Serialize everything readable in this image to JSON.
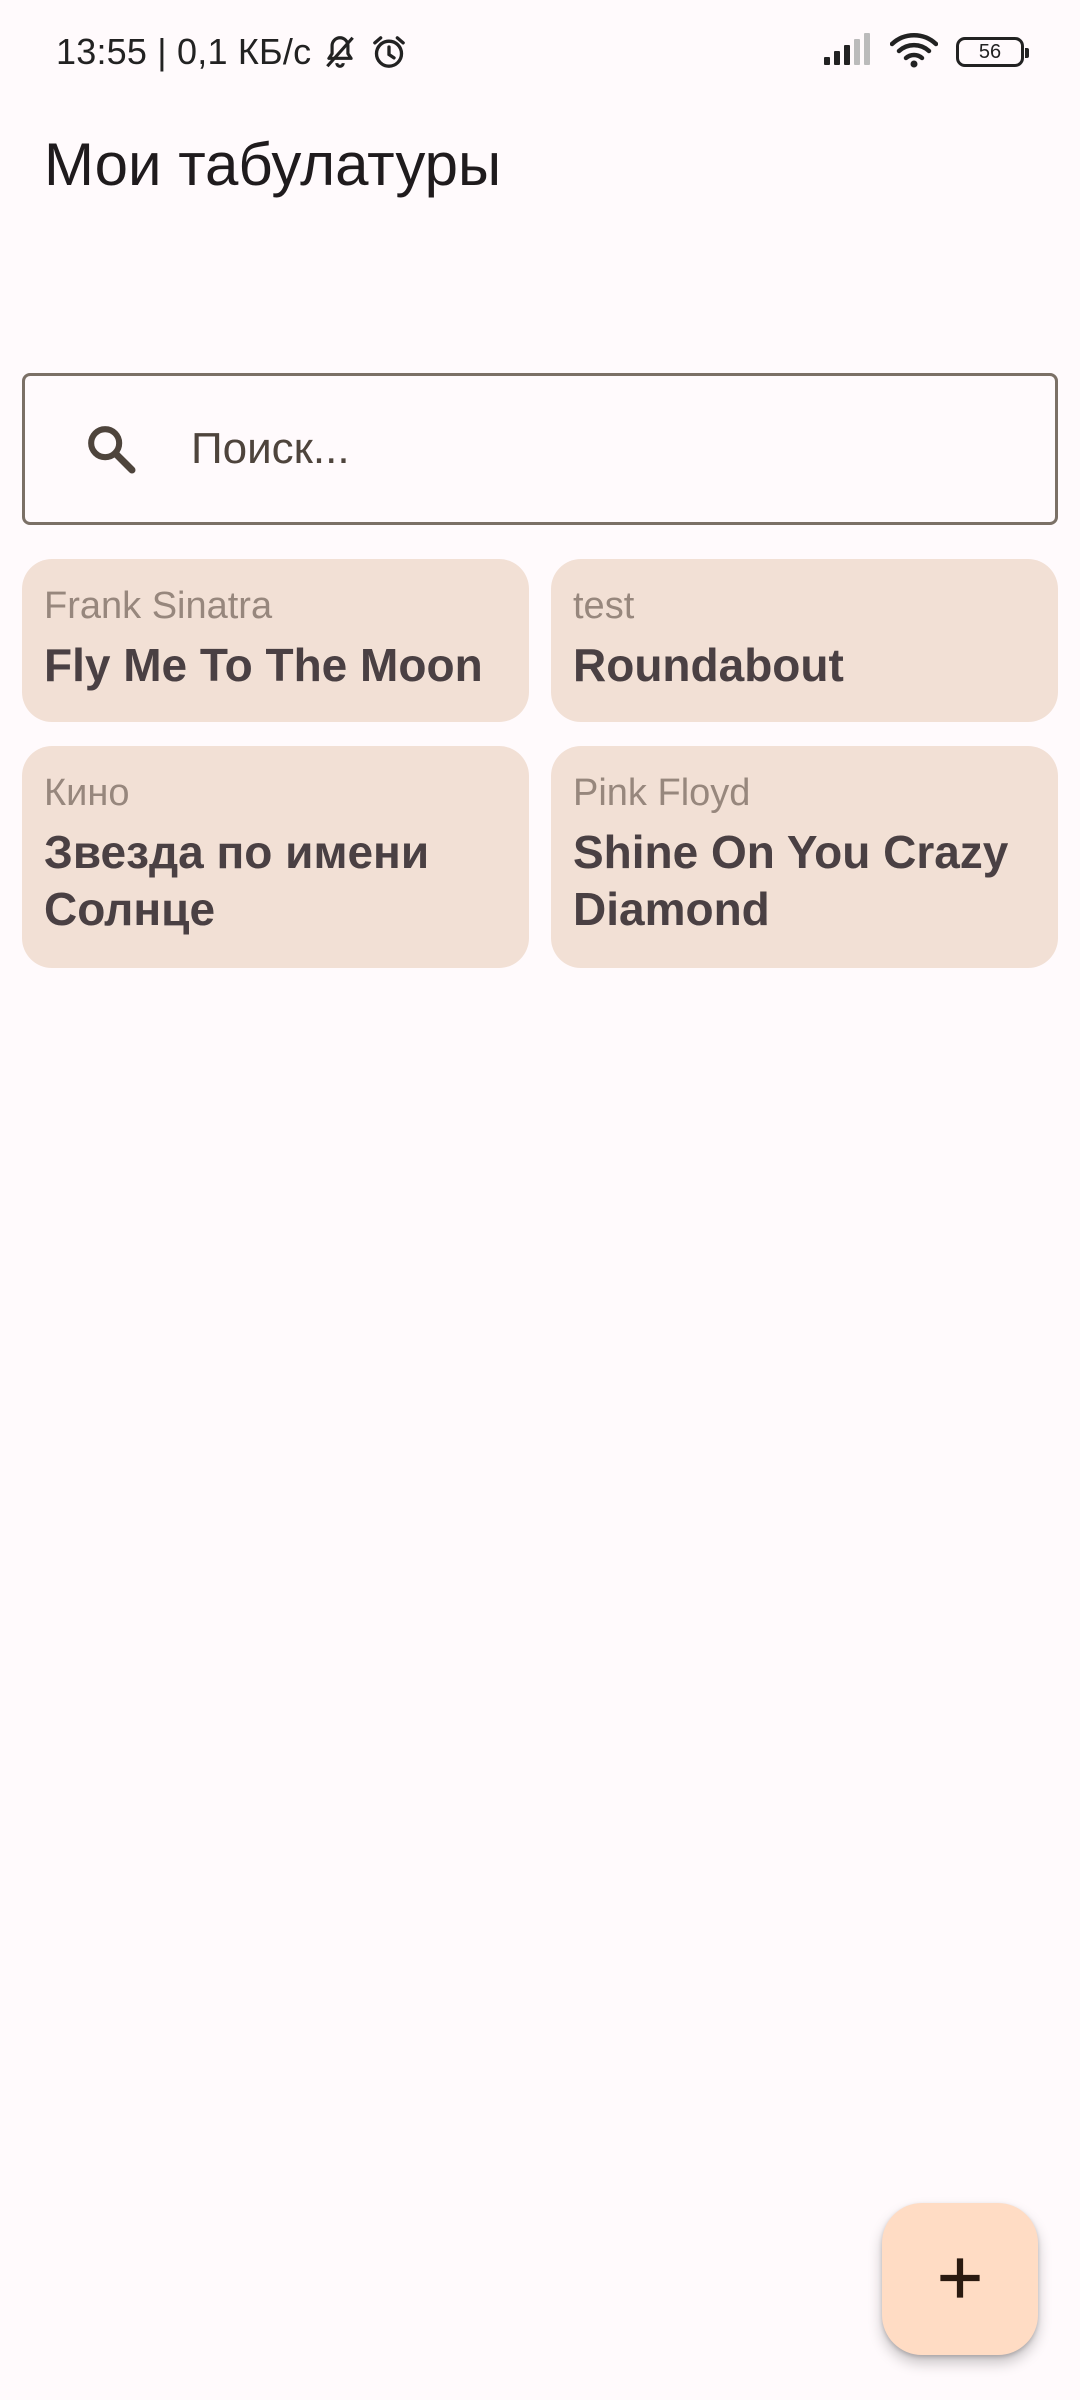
{
  "status_bar": {
    "time_and_speed": "13:55 | 0,1 КБ/с",
    "battery_level": "56",
    "icons": [
      "bell-off-icon",
      "alarm-icon",
      "signal-icon",
      "wifi-icon",
      "battery-icon"
    ]
  },
  "header": {
    "title": "Мои табулатуры"
  },
  "search": {
    "placeholder": "Поиск..."
  },
  "tabs": [
    {
      "artist": "Frank Sinatra",
      "title": "Fly Me To The Moon"
    },
    {
      "artist": "test",
      "title": "Roundabout"
    },
    {
      "artist": "Кино",
      "title": "Звезда по имени Солнце"
    },
    {
      "artist": "Pink Floyd",
      "title": "Shine On You Crazy Diamond"
    }
  ],
  "fab": {
    "icon": "plus-icon"
  },
  "colors": {
    "background": "#fffafc",
    "card": "#f2e0d5",
    "fab": "#ffdcc4",
    "title_text": "#4a4043",
    "artist_text": "#97877d"
  }
}
